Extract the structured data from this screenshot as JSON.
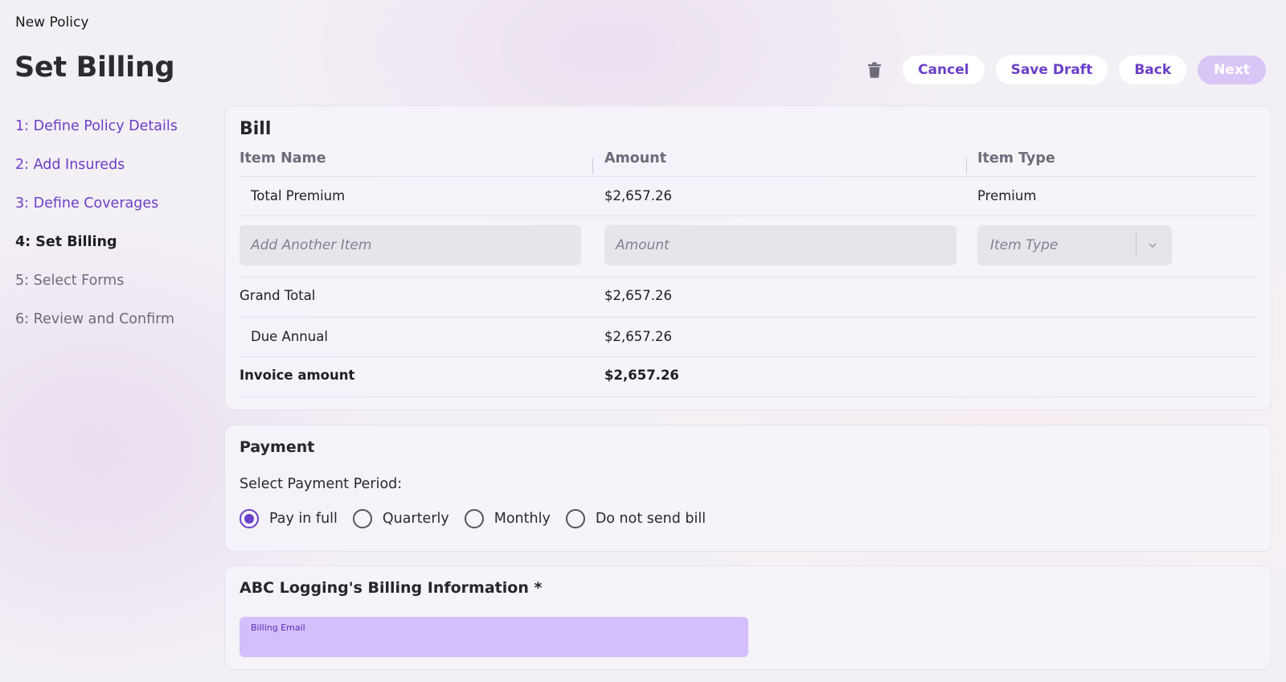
{
  "breadcrumb": "New Policy",
  "title": "Set Billing",
  "steps": [
    {
      "label": "1: Define Policy Details",
      "state": "done"
    },
    {
      "label": "2: Add Insureds",
      "state": "done"
    },
    {
      "label": "3: Define Coverages",
      "state": "done"
    },
    {
      "label": "4: Set Billing",
      "state": "current"
    },
    {
      "label": "5: Select Forms",
      "state": "pending"
    },
    {
      "label": "6: Review and Confirm",
      "state": "pending"
    }
  ],
  "actions": {
    "trash_icon": "trash-icon",
    "cancel": "Cancel",
    "save_draft": "Save Draft",
    "back": "Back",
    "next": "Next"
  },
  "bill": {
    "title": "Bill",
    "columns": [
      "Item Name",
      "Amount",
      "Item Type"
    ],
    "items": [
      {
        "name": "Total Premium",
        "amount": "$2,657.26",
        "type": "Premium"
      }
    ],
    "new_item": {
      "name_placeholder": "Add Another Item",
      "amount_placeholder": "Amount",
      "type_placeholder": "Item Type"
    },
    "grand_total": {
      "label": "Grand Total",
      "amount": "$2,657.26"
    },
    "due": {
      "label": "Due Annual",
      "amount": "$2,657.26"
    },
    "invoice": {
      "label": "Invoice amount",
      "amount": "$2,657.26"
    }
  },
  "payment": {
    "title": "Payment",
    "label": "Select Payment Period:",
    "options": [
      "Pay in full",
      "Quarterly",
      "Monthly",
      "Do not send bill"
    ],
    "selected": "Pay in full"
  },
  "billing_info": {
    "title": "ABC Logging's Billing Information *",
    "email_label": "Billing Email",
    "email_value": ""
  },
  "colors": {
    "accent": "#6b3fc8",
    "disabled_button": "#d8c6f7",
    "email_field": "#d3bffb"
  }
}
